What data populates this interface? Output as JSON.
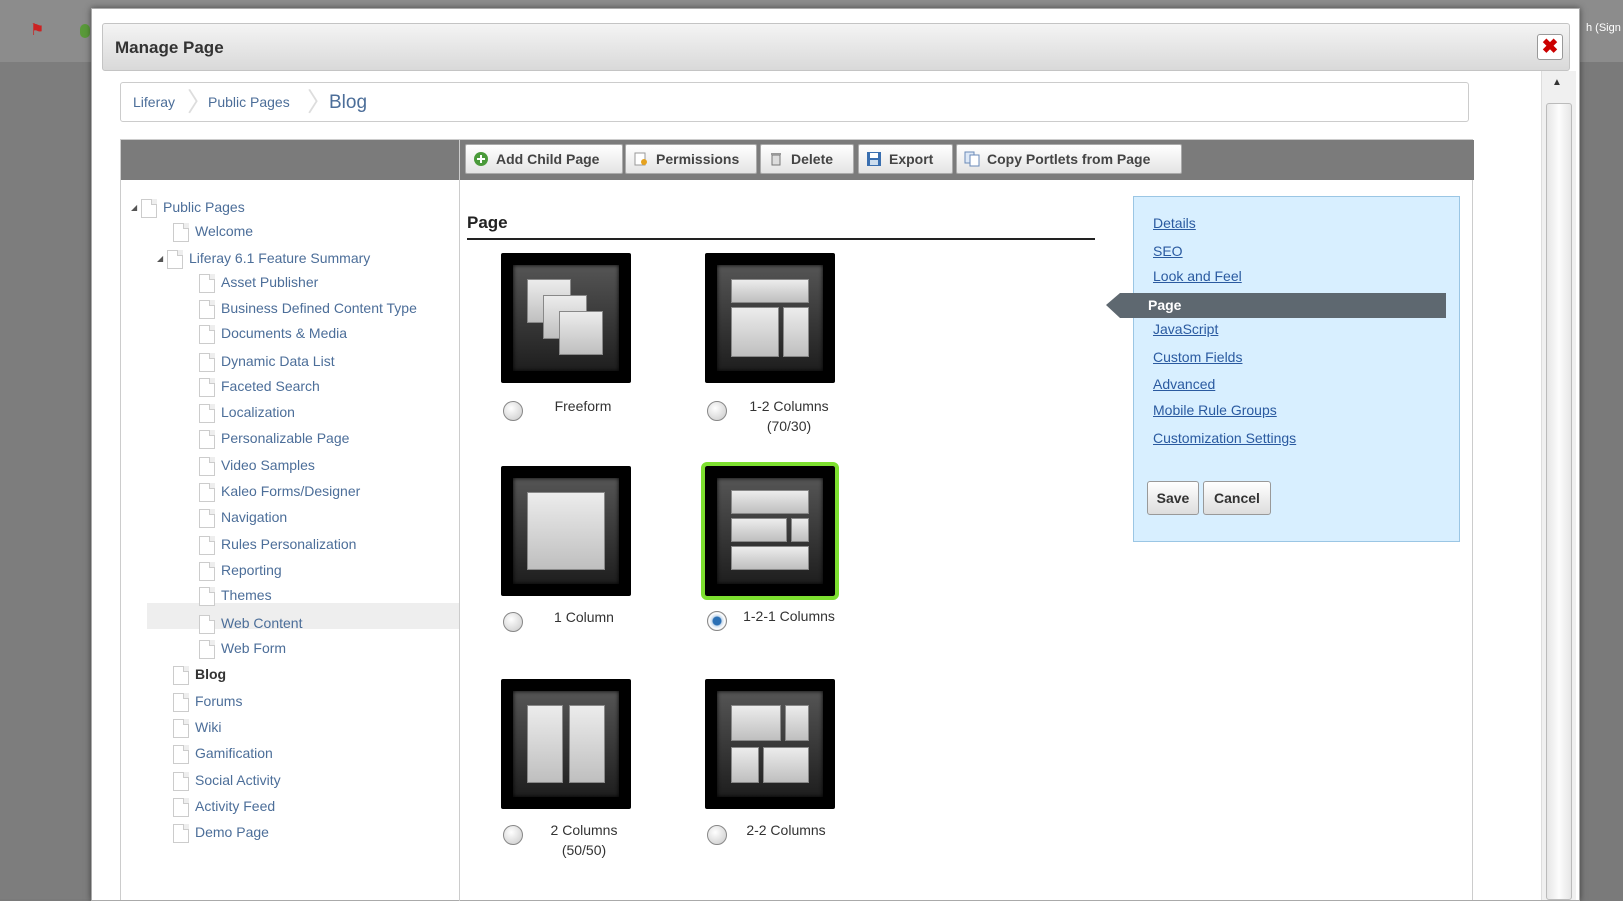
{
  "dialog": {
    "title": "Manage Page"
  },
  "background": {
    "right_text": "h (Sign"
  },
  "breadcrumb": {
    "items": [
      "Liferay",
      "Public Pages"
    ],
    "current": "Blog"
  },
  "toolbar": {
    "add_child_page": "Add Child Page",
    "permissions": "Permissions",
    "delete": "Delete",
    "export": "Export",
    "copy_portlets": "Copy Portlets from Page"
  },
  "tree": {
    "root": "Public Pages",
    "welcome": "Welcome",
    "feature_summary": "Liferay 6.1 Feature Summary",
    "children": [
      "Asset Publisher",
      "Business Defined Content Type",
      "Documents & Media",
      "Dynamic Data List",
      "Faceted Search",
      "Localization",
      "Personalizable Page",
      "Video Samples",
      "Kaleo Forms/Designer",
      "Navigation",
      "Rules Personalization",
      "Reporting",
      "Themes",
      "Web Content",
      "Web Form"
    ],
    "siblings": [
      "Blog",
      "Forums",
      "Wiki",
      "Gamification",
      "Social Activity",
      "Activity Feed",
      "Demo Page"
    ],
    "selected": "Blog"
  },
  "page_section": {
    "title": "Page"
  },
  "layouts": [
    {
      "label": "Freeform",
      "selected": false
    },
    {
      "label": "1-2 Columns\n(70/30)",
      "selected": false
    },
    {
      "label": "1 Column",
      "selected": false
    },
    {
      "label": "1-2-1 Columns",
      "selected": true
    },
    {
      "label": "2 Columns\n(50/50)",
      "selected": false
    },
    {
      "label": "2-2 Columns",
      "selected": false
    }
  ],
  "side_nav": {
    "links": [
      "Details",
      "SEO",
      "Look and Feel",
      "Page",
      "JavaScript",
      "Custom Fields",
      "Advanced",
      "Mobile Rule Groups",
      "Customization Settings"
    ],
    "active": "Page",
    "save_label": "Save",
    "cancel_label": "Cancel"
  },
  "colors": {
    "accent_link": "#4c6e99",
    "selected_outline": "#7ddf2f",
    "side_panel_bg": "#d8efff"
  }
}
